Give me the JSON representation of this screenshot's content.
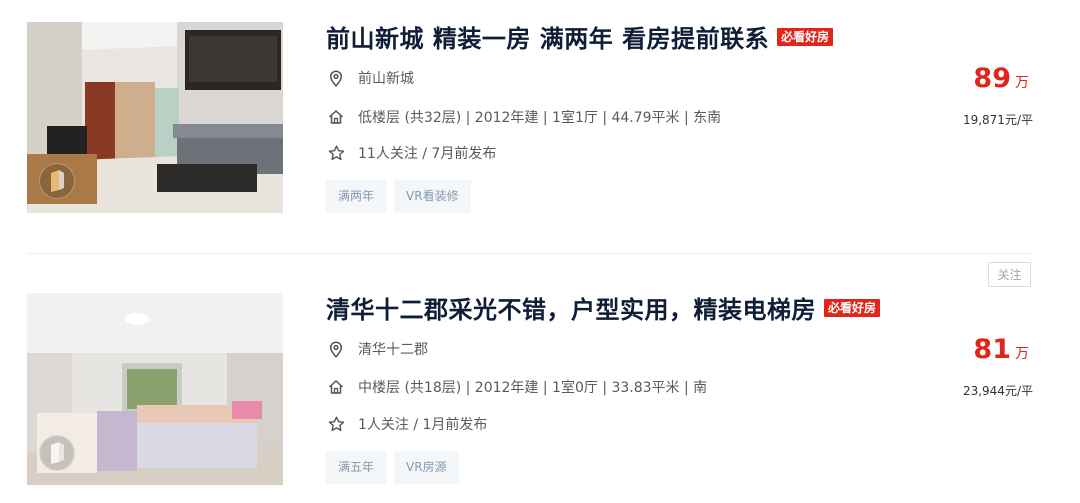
{
  "listings": [
    {
      "title": "前山新城 精装一房 满两年 看房提前联系",
      "badge": "必看好房",
      "community": "前山新城",
      "details": "低楼层 (共32层) | 2012年建 | 1室1厅 | 44.79平米 | 东南",
      "follow_info": "11人关注 / 7月前发布",
      "tags": [
        "满两年",
        "VR看装修"
      ],
      "price": "89",
      "price_unit": "万",
      "unit_price": "19,871元/平"
    },
    {
      "title": "清华十二郡采光不错，户型实用，精装电梯房",
      "badge": "必看好房",
      "community": "清华十二郡",
      "details": "中楼层 (共18层) | 2012年建 | 1室0厅 | 33.83平米 | 南",
      "follow_info": "1人关注 / 1月前发布",
      "tags": [
        "满五年",
        "VR房源"
      ],
      "price": "81",
      "price_unit": "万",
      "unit_price": "23,944元/平"
    }
  ],
  "follow_button": "关注",
  "icons": {
    "location": "location-pin-icon",
    "house": "house-icon",
    "star": "star-icon",
    "vr": "vr-icon"
  },
  "colors": {
    "price": "#e1251b",
    "badge_bg": "#e1251b",
    "title": "#101d37",
    "tag_bg": "#f4f7f9",
    "tag_text": "#849aae"
  }
}
